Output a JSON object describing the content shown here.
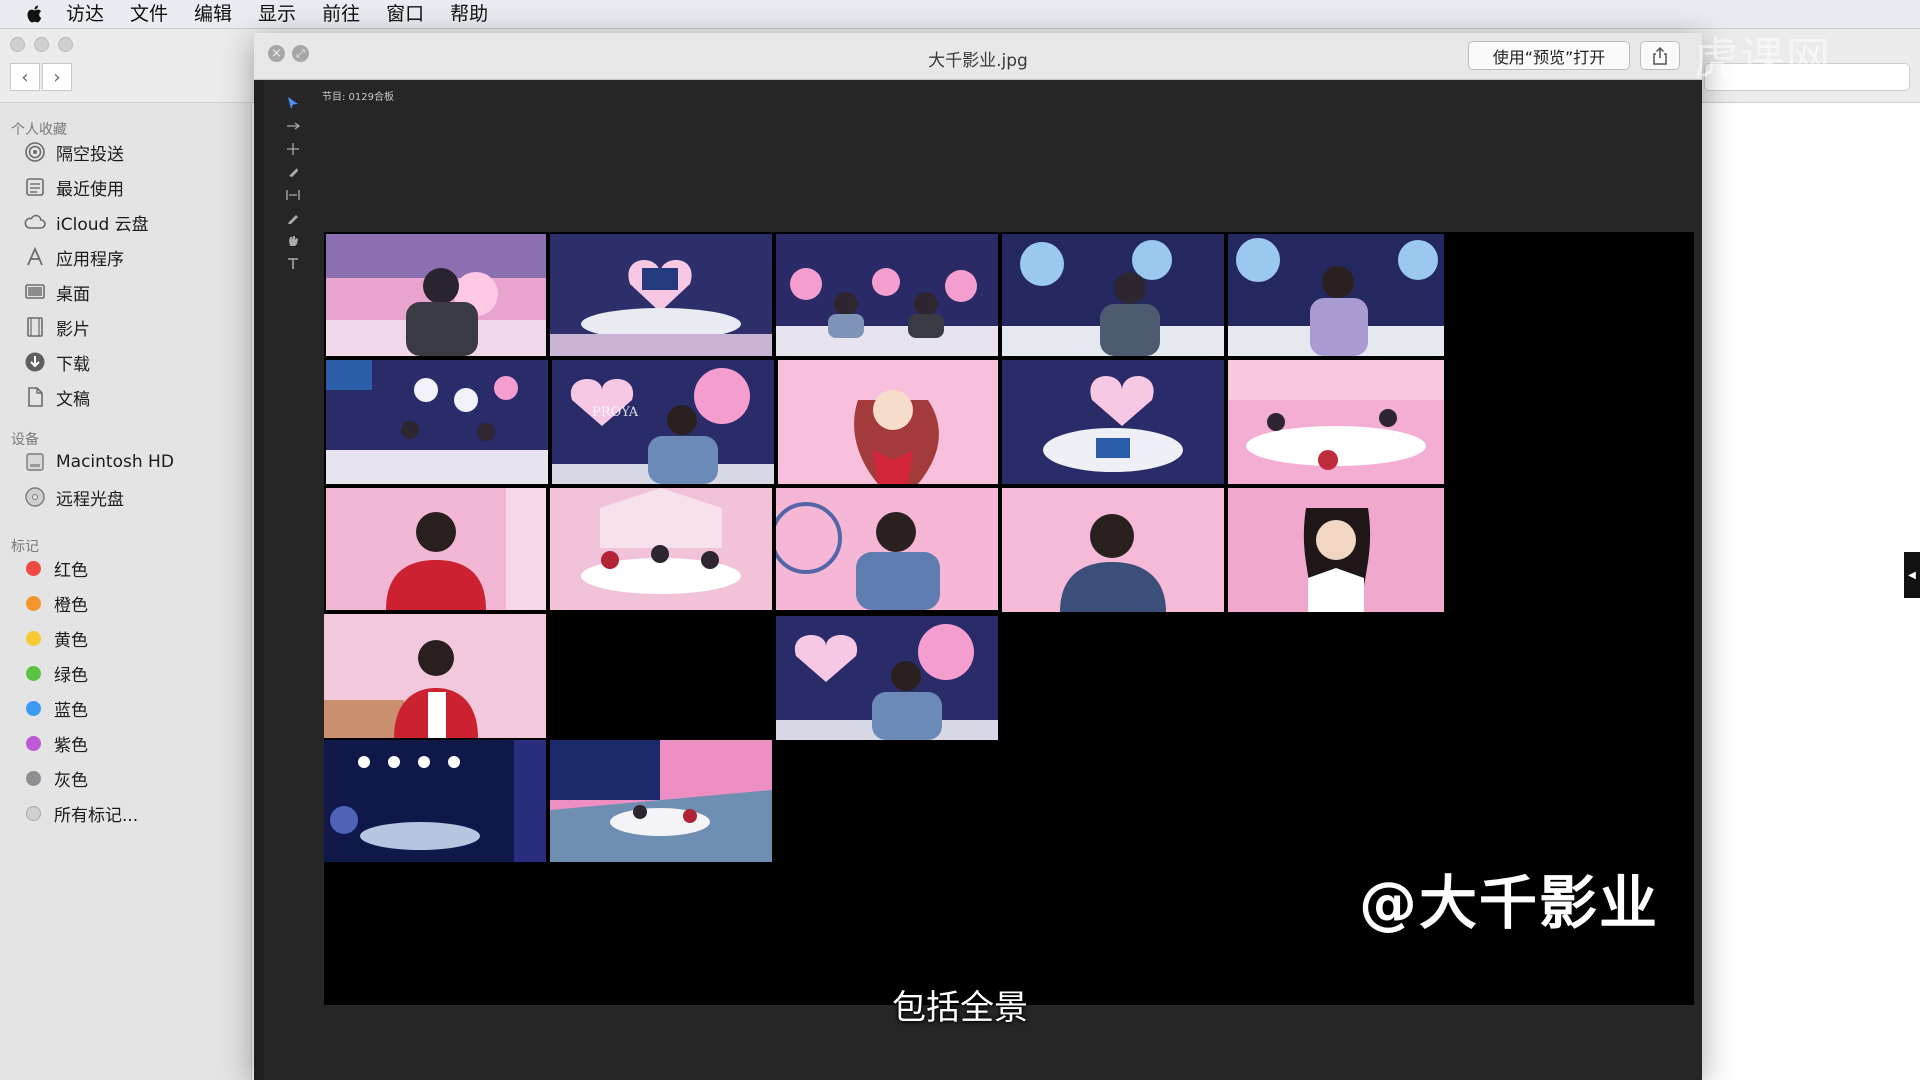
{
  "menubar": {
    "apple": "apple-icon",
    "items": [
      "访达",
      "文件",
      "编辑",
      "显示",
      "前往",
      "窗口",
      "帮助"
    ]
  },
  "finder": {
    "sidebar": {
      "favorites_header": "个人收藏",
      "favorites": [
        {
          "label": "隔空投送",
          "icon": "airdrop-icon"
        },
        {
          "label": "最近使用",
          "icon": "recents-icon"
        },
        {
          "label": "iCloud 云盘",
          "icon": "cloud-icon"
        },
        {
          "label": "应用程序",
          "icon": "applications-icon"
        },
        {
          "label": "桌面",
          "icon": "desktop-icon"
        },
        {
          "label": "影片",
          "icon": "movies-icon"
        },
        {
          "label": "下载",
          "icon": "downloads-icon"
        },
        {
          "label": "文稿",
          "icon": "documents-icon"
        }
      ],
      "devices_header": "设备",
      "devices": [
        {
          "label": "Macintosh HD",
          "icon": "disk-icon"
        },
        {
          "label": "远程光盘",
          "icon": "optical-disc-icon"
        }
      ],
      "tags_header": "标记",
      "tags": [
        {
          "label": "红色",
          "color": "#f04a43"
        },
        {
          "label": "橙色",
          "color": "#f7952d"
        },
        {
          "label": "黄色",
          "color": "#f7c933"
        },
        {
          "label": "绿色",
          "color": "#5ac344"
        },
        {
          "label": "蓝色",
          "color": "#3d9af4"
        },
        {
          "label": "紫色",
          "color": "#bd5ad8"
        },
        {
          "label": "灰色",
          "color": "#8e8e92"
        }
      ],
      "all_tags": "所有标记..."
    }
  },
  "quicklook": {
    "filename": "大千影业.jpg",
    "open_button": "使用“预览”打开",
    "share_icon": "share-icon",
    "sequence_label": "节目: 0129合板",
    "watermark": "@大千影业",
    "subtitle": "包括全景",
    "brand_label": "PROYA"
  },
  "site_logo": "虎课网",
  "colors": {
    "menubar_bg": "#e9edf2",
    "sidebar_bg": "#e4e4e4",
    "viewer_bg": "#262626",
    "pink": "#f4a8cf",
    "navy": "#1d2250"
  }
}
